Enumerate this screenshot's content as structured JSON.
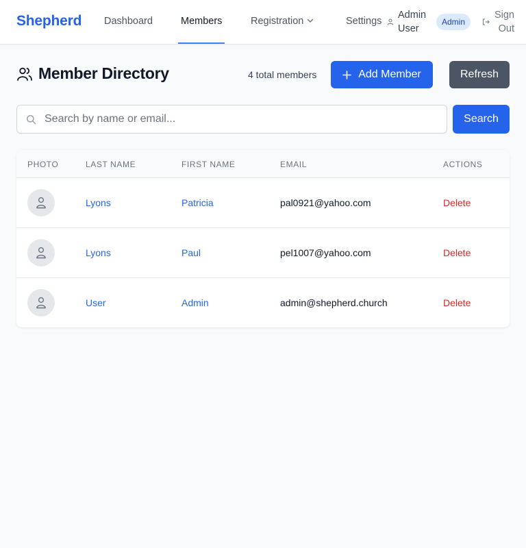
{
  "app": {
    "brand": "Shepherd"
  },
  "nav": {
    "dashboard": "Dashboard",
    "members": "Members",
    "registration": "Registration",
    "settings": "Settings",
    "user_name": "Admin User",
    "role_badge": "Admin",
    "sign_out": "Sign Out"
  },
  "page": {
    "title": "Member Directory",
    "total_text": "4 total members",
    "add_button": "Add Member",
    "refresh_button": "Refresh"
  },
  "search": {
    "placeholder": "Search by name or email...",
    "value": "",
    "button": "Search"
  },
  "table": {
    "columns": [
      "Photo",
      "Last Name",
      "First Name",
      "Email",
      "Actions"
    ],
    "rows": [
      {
        "last": "Lyons",
        "first": "Patricia",
        "email": "pal0921@yahoo.com",
        "action": "Delete"
      },
      {
        "last": "Lyons",
        "first": "Paul",
        "email": "pel1007@yahoo.com",
        "action": "Delete"
      },
      {
        "last": "User",
        "first": "Admin",
        "email": "admin@shepherd.church",
        "action": "Delete"
      }
    ]
  },
  "colors": {
    "primary": "#2563eb",
    "secondary_button": "#4b5563",
    "danger": "#dc2626",
    "badge_bg": "#dbeafe",
    "page_bg": "#f9fafb"
  },
  "icons": [
    "users-icon",
    "plus-icon",
    "search-icon",
    "user-icon",
    "sign-out-icon",
    "chevron-down-icon",
    "avatar-icon"
  ]
}
